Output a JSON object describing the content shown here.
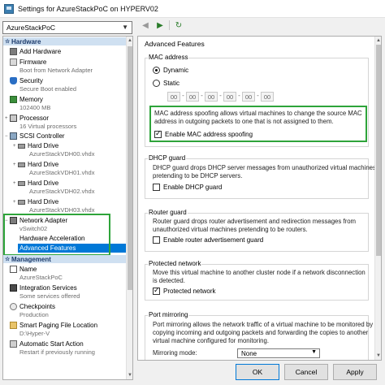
{
  "window": {
    "title": "Settings for AzureStackPoC on HYPERV02"
  },
  "server": {
    "selected": "AzureStackPoC"
  },
  "hardware": {
    "header": "Hardware",
    "items": [
      {
        "label": "Add Hardware"
      },
      {
        "label": "Firmware",
        "sub": "Boot from Network Adapter"
      },
      {
        "label": "Security",
        "sub": "Secure Boot enabled"
      },
      {
        "label": "Memory",
        "sub": "102400 MB"
      },
      {
        "label": "Processor",
        "sub": "16 Virtual processors"
      },
      {
        "label": "SCSI Controller"
      },
      {
        "label": "Hard Drive",
        "sub": "AzureStackVDH00.vhdx"
      },
      {
        "label": "Hard Drive",
        "sub": "AzureStackVDH01.vhdx"
      },
      {
        "label": "Hard Drive",
        "sub": "AzureStackVDH02.vhdx"
      },
      {
        "label": "Hard Drive",
        "sub": "AzureStackVDH03.vhdx"
      },
      {
        "label": "Network Adapter",
        "sub": "vSwitch02"
      },
      {
        "label": "Hardware Acceleration"
      },
      {
        "label": "Advanced Features"
      }
    ]
  },
  "management": {
    "header": "Management",
    "items": [
      {
        "label": "Name",
        "sub": "AzureStackPoC"
      },
      {
        "label": "Integration Services",
        "sub": "Some services offered"
      },
      {
        "label": "Checkpoints",
        "sub": "Production"
      },
      {
        "label": "Smart Paging File Location",
        "sub": "D:\\Hyper-V"
      },
      {
        "label": "Automatic Start Action",
        "sub": "Restart if previously running"
      }
    ]
  },
  "advanced": {
    "title": "Advanced Features",
    "mac": {
      "legend": "MAC address",
      "dynamic": "Dynamic",
      "static": "Static",
      "fields": [
        "00",
        "00",
        "00",
        "00",
        "00",
        "00"
      ],
      "desc": [
        "MAC address spoofing allows virtual machines to change the source MAC",
        "address in outgoing packets to one that is not assigned to them."
      ],
      "spoof_label": "Enable MAC address spoofing"
    },
    "dhcp": {
      "legend": "DHCP guard",
      "desc": [
        "DHCP guard drops DHCP server messages from unauthorized virtual machines",
        "pretending to be DHCP servers."
      ],
      "check_label": "Enable DHCP guard"
    },
    "router": {
      "legend": "Router guard",
      "desc": [
        "Router guard drops router advertisement and redirection messages from",
        "unauthorized virtual machines pretending to be routers."
      ],
      "check_label": "Enable router advertisement guard"
    },
    "protected": {
      "legend": "Protected network",
      "desc": [
        "Move this virtual machine to another cluster node if a network disconnection",
        "is detected."
      ],
      "check_label": "Protected network"
    },
    "mirroring": {
      "legend": "Port mirroring",
      "desc": [
        "Port mirroring allows the network traffic of a virtual machine to be monitored by",
        "copying incoming and outgoing packets and forwarding the copies to another",
        "virtual machine configured for monitoring."
      ],
      "mode_label": "Mirroring mode:",
      "mode_value": "None"
    }
  },
  "buttons": {
    "ok": "OK",
    "cancel": "Cancel",
    "apply": "Apply"
  },
  "colors": {
    "selection": "#0078d7",
    "highlight_box": "#2ea43a",
    "section_header": "#cfe0f1"
  }
}
